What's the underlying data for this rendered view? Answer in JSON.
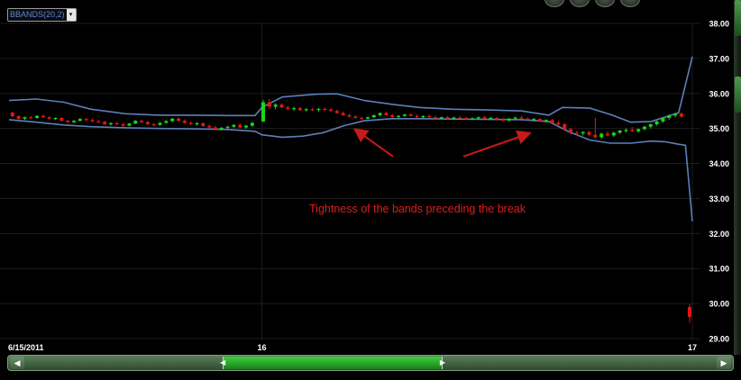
{
  "indicator": {
    "label": "BBANDS(20,2)",
    "arrow": "▾"
  },
  "annotation": {
    "text": "Tightness of the bands preceding the break",
    "color": "#e01c1c"
  },
  "scrollbar": {
    "left_arrow": "◀",
    "right_arrow": "▶",
    "grip_left": "◀",
    "grip_right": "▶"
  },
  "colors": {
    "background": "#000000",
    "grid": "#1d1d1d",
    "band": "#5c80b8",
    "up_candle": "#18d818",
    "down_candle": "#e01818",
    "axis_text": "#ffffff",
    "annotation_arrow": "#c81a1a"
  },
  "chart_data": {
    "type": "candlestick",
    "title": "",
    "xlabel": "",
    "ylabel": "",
    "ylim": [
      29.0,
      38.0
    ],
    "y_ticks": [
      "38.00",
      "37.00",
      "36.00",
      "35.00",
      "34.00",
      "33.00",
      "32.00",
      "31.00",
      "30.00",
      "29.00"
    ],
    "x_tick_labels": [
      {
        "label": "6/15/2011",
        "t": 0
      },
      {
        "label": "16",
        "t": 0.37
      },
      {
        "label": "17",
        "t": 1.0
      }
    ],
    "grid": true,
    "bands": {
      "name": "BBANDS(20,2)",
      "upper": [
        [
          0.0,
          35.8
        ],
        [
          0.04,
          35.84
        ],
        [
          0.08,
          35.75
        ],
        [
          0.12,
          35.55
        ],
        [
          0.17,
          35.42
        ],
        [
          0.22,
          35.38
        ],
        [
          0.27,
          35.38
        ],
        [
          0.32,
          35.37
        ],
        [
          0.36,
          35.37
        ],
        [
          0.37,
          35.6
        ],
        [
          0.4,
          35.9
        ],
        [
          0.45,
          35.98
        ],
        [
          0.48,
          35.99
        ],
        [
          0.52,
          35.8
        ],
        [
          0.56,
          35.69
        ],
        [
          0.6,
          35.6
        ],
        [
          0.65,
          35.55
        ],
        [
          0.7,
          35.53
        ],
        [
          0.75,
          35.5
        ],
        [
          0.79,
          35.38
        ],
        [
          0.81,
          35.6
        ],
        [
          0.85,
          35.58
        ],
        [
          0.88,
          35.4
        ],
        [
          0.91,
          35.18
        ],
        [
          0.94,
          35.2
        ],
        [
          0.98,
          35.45
        ],
        [
          1.0,
          37.05
        ]
      ],
      "middle": [
        [
          0.0,
          35.4
        ],
        [
          0.05,
          35.32
        ],
        [
          0.1,
          35.2
        ],
        [
          0.15,
          35.14
        ],
        [
          0.2,
          35.1
        ],
        [
          0.25,
          35.08
        ],
        [
          0.3,
          35.06
        ],
        [
          0.34,
          35.05
        ],
        [
          0.37,
          35.15
        ],
        [
          0.4,
          35.4
        ],
        [
          0.45,
          35.5
        ],
        [
          0.5,
          35.46
        ],
        [
          0.55,
          35.4
        ],
        [
          0.6,
          35.37
        ],
        [
          0.65,
          35.34
        ],
        [
          0.7,
          35.32
        ],
        [
          0.75,
          35.3
        ],
        [
          0.79,
          35.25
        ],
        [
          0.82,
          35.05
        ],
        [
          0.86,
          34.88
        ],
        [
          0.9,
          34.9
        ],
        [
          0.94,
          34.95
        ],
        [
          0.98,
          35.1
        ],
        [
          1.0,
          35.1
        ]
      ],
      "lower": [
        [
          0.0,
          35.25
        ],
        [
          0.04,
          35.18
        ],
        [
          0.08,
          35.1
        ],
        [
          0.12,
          35.05
        ],
        [
          0.17,
          35.02
        ],
        [
          0.22,
          35.0
        ],
        [
          0.27,
          34.99
        ],
        [
          0.32,
          34.97
        ],
        [
          0.36,
          34.92
        ],
        [
          0.37,
          34.82
        ],
        [
          0.4,
          34.75
        ],
        [
          0.43,
          34.78
        ],
        [
          0.46,
          34.88
        ],
        [
          0.49,
          35.08
        ],
        [
          0.52,
          35.22
        ],
        [
          0.56,
          35.28
        ],
        [
          0.6,
          35.28
        ],
        [
          0.65,
          35.27
        ],
        [
          0.7,
          35.26
        ],
        [
          0.75,
          35.25
        ],
        [
          0.79,
          35.2
        ],
        [
          0.82,
          34.9
        ],
        [
          0.85,
          34.67
        ],
        [
          0.88,
          34.58
        ],
        [
          0.91,
          34.58
        ],
        [
          0.94,
          34.64
        ],
        [
          0.96,
          34.62
        ],
        [
          0.98,
          34.55
        ],
        [
          0.99,
          34.52
        ],
        [
          1.0,
          32.35
        ]
      ]
    },
    "candles": [
      [
        0.005,
        35.45,
        35.48,
        35.32,
        35.35
      ],
      [
        0.014,
        35.35,
        35.38,
        35.25,
        35.28
      ],
      [
        0.023,
        35.28,
        35.34,
        35.24,
        35.32
      ],
      [
        0.032,
        35.32,
        35.36,
        35.28,
        35.3
      ],
      [
        0.041,
        35.3,
        35.38,
        35.28,
        35.36
      ],
      [
        0.05,
        35.36,
        35.4,
        35.3,
        35.32
      ],
      [
        0.059,
        35.32,
        35.35,
        35.25,
        35.28
      ],
      [
        0.068,
        35.28,
        35.32,
        35.24,
        35.3
      ],
      [
        0.077,
        35.3,
        35.32,
        35.2,
        35.22
      ],
      [
        0.086,
        35.22,
        35.25,
        35.16,
        35.18
      ],
      [
        0.095,
        35.18,
        35.24,
        35.15,
        35.22
      ],
      [
        0.104,
        35.22,
        35.3,
        35.2,
        35.27
      ],
      [
        0.113,
        35.27,
        35.3,
        35.2,
        35.24
      ],
      [
        0.122,
        35.24,
        35.28,
        35.18,
        35.2
      ],
      [
        0.131,
        35.2,
        35.25,
        35.16,
        35.19
      ],
      [
        0.14,
        35.19,
        35.22,
        35.1,
        35.12
      ],
      [
        0.149,
        35.12,
        35.18,
        35.08,
        35.15
      ],
      [
        0.158,
        35.15,
        35.2,
        35.1,
        35.12
      ],
      [
        0.167,
        35.12,
        35.16,
        35.04,
        35.08
      ],
      [
        0.176,
        35.08,
        35.16,
        35.06,
        35.14
      ],
      [
        0.185,
        35.14,
        35.24,
        35.12,
        35.22
      ],
      [
        0.194,
        35.22,
        35.26,
        35.16,
        35.18
      ],
      [
        0.203,
        35.18,
        35.22,
        35.1,
        35.12
      ],
      [
        0.212,
        35.12,
        35.16,
        35.06,
        35.1
      ],
      [
        0.221,
        35.1,
        35.18,
        35.08,
        35.16
      ],
      [
        0.23,
        35.16,
        35.24,
        35.14,
        35.21
      ],
      [
        0.239,
        35.21,
        35.3,
        35.18,
        35.28
      ],
      [
        0.248,
        35.28,
        35.32,
        35.2,
        35.22
      ],
      [
        0.257,
        35.22,
        35.26,
        35.14,
        35.16
      ],
      [
        0.266,
        35.16,
        35.2,
        35.1,
        35.13
      ],
      [
        0.275,
        35.13,
        35.18,
        35.08,
        35.15
      ],
      [
        0.284,
        35.15,
        35.18,
        35.05,
        35.07
      ],
      [
        0.293,
        35.07,
        35.12,
        35.0,
        35.03
      ],
      [
        0.302,
        35.03,
        35.08,
        34.95,
        34.98
      ],
      [
        0.311,
        34.98,
        35.04,
        34.94,
        35.02
      ],
      [
        0.32,
        35.02,
        35.08,
        34.98,
        35.05
      ],
      [
        0.329,
        35.05,
        35.12,
        35.02,
        35.1
      ],
      [
        0.338,
        35.1,
        35.15,
        35.0,
        35.03
      ],
      [
        0.347,
        35.03,
        35.1,
        34.99,
        35.08
      ],
      [
        0.356,
        35.08,
        35.18,
        35.05,
        35.16
      ],
      [
        0.372,
        35.2,
        35.82,
        35.18,
        35.75
      ],
      [
        0.381,
        35.75,
        35.85,
        35.55,
        35.62
      ],
      [
        0.39,
        35.62,
        35.72,
        35.55,
        35.68
      ],
      [
        0.399,
        35.68,
        35.72,
        35.58,
        35.6
      ],
      [
        0.408,
        35.6,
        35.65,
        35.52,
        35.56
      ],
      [
        0.417,
        35.56,
        35.62,
        35.5,
        35.58
      ],
      [
        0.426,
        35.58,
        35.62,
        35.5,
        35.52
      ],
      [
        0.435,
        35.52,
        35.58,
        35.48,
        35.55
      ],
      [
        0.444,
        35.55,
        35.58,
        35.5,
        35.53
      ],
      [
        0.453,
        35.53,
        35.58,
        35.48,
        35.56
      ],
      [
        0.462,
        35.56,
        35.6,
        35.5,
        35.54
      ],
      [
        0.471,
        35.54,
        35.58,
        35.48,
        35.5
      ],
      [
        0.48,
        35.5,
        35.54,
        35.42,
        35.44
      ],
      [
        0.489,
        35.44,
        35.48,
        35.36,
        35.38
      ],
      [
        0.498,
        35.38,
        35.42,
        35.32,
        35.34
      ],
      [
        0.507,
        35.34,
        35.38,
        35.28,
        35.3
      ],
      [
        0.516,
        35.3,
        35.34,
        35.24,
        35.28
      ],
      [
        0.525,
        35.28,
        35.34,
        35.26,
        35.32
      ],
      [
        0.534,
        35.32,
        35.4,
        35.3,
        35.38
      ],
      [
        0.543,
        35.38,
        35.46,
        35.34,
        35.44
      ],
      [
        0.552,
        35.44,
        35.48,
        35.36,
        35.38
      ],
      [
        0.561,
        35.38,
        35.42,
        35.3,
        35.33
      ],
      [
        0.57,
        35.33,
        35.38,
        35.28,
        35.36
      ],
      [
        0.579,
        35.36,
        35.42,
        35.33,
        35.4
      ],
      [
        0.588,
        35.4,
        35.44,
        35.34,
        35.36
      ],
      [
        0.597,
        35.36,
        35.4,
        35.3,
        35.33
      ],
      [
        0.606,
        35.33,
        35.38,
        35.28,
        35.35
      ],
      [
        0.615,
        35.35,
        35.4,
        35.3,
        35.32
      ],
      [
        0.624,
        35.32,
        35.36,
        35.26,
        35.29
      ],
      [
        0.633,
        35.29,
        35.34,
        35.26,
        35.32
      ],
      [
        0.642,
        35.32,
        35.36,
        35.26,
        35.28
      ],
      [
        0.651,
        35.28,
        35.34,
        35.24,
        35.31
      ],
      [
        0.66,
        35.31,
        35.36,
        35.28,
        35.3
      ],
      [
        0.669,
        35.3,
        35.34,
        35.24,
        35.27
      ],
      [
        0.678,
        35.27,
        35.32,
        35.24,
        35.29
      ],
      [
        0.687,
        35.29,
        35.34,
        35.26,
        35.32
      ],
      [
        0.696,
        35.32,
        35.36,
        35.26,
        35.28
      ],
      [
        0.705,
        35.28,
        35.33,
        35.24,
        35.3
      ],
      [
        0.714,
        35.3,
        35.34,
        35.24,
        35.26
      ],
      [
        0.723,
        35.26,
        35.3,
        35.2,
        35.23
      ],
      [
        0.732,
        35.23,
        35.3,
        35.2,
        35.28
      ],
      [
        0.741,
        35.28,
        35.34,
        35.24,
        35.31
      ],
      [
        0.75,
        35.31,
        35.36,
        35.26,
        35.28
      ],
      [
        0.759,
        35.28,
        35.32,
        35.22,
        35.25
      ],
      [
        0.768,
        35.25,
        35.3,
        35.2,
        35.27
      ],
      [
        0.777,
        35.27,
        35.3,
        35.18,
        35.2
      ],
      [
        0.786,
        35.2,
        35.26,
        35.16,
        35.24
      ],
      [
        0.795,
        35.24,
        35.28,
        35.14,
        35.16
      ],
      [
        0.804,
        35.16,
        35.22,
        35.08,
        35.12
      ],
      [
        0.813,
        35.12,
        35.16,
        34.95,
        34.98
      ],
      [
        0.822,
        34.98,
        35.02,
        34.84,
        34.88
      ],
      [
        0.831,
        34.88,
        34.94,
        34.8,
        34.86
      ],
      [
        0.84,
        34.86,
        34.92,
        34.8,
        34.9
      ],
      [
        0.849,
        34.9,
        34.94,
        34.78,
        34.82
      ],
      [
        0.858,
        34.82,
        35.3,
        34.7,
        34.75
      ],
      [
        0.867,
        34.75,
        34.88,
        34.7,
        34.85
      ],
      [
        0.876,
        34.85,
        34.92,
        34.78,
        34.8
      ],
      [
        0.885,
        34.8,
        34.9,
        34.76,
        34.88
      ],
      [
        0.894,
        34.88,
        34.96,
        34.84,
        34.94
      ],
      [
        0.903,
        34.94,
        35.0,
        34.88,
        34.96
      ],
      [
        0.912,
        34.96,
        35.04,
        34.9,
        34.92
      ],
      [
        0.921,
        34.92,
        35.0,
        34.88,
        34.98
      ],
      [
        0.93,
        34.98,
        35.08,
        34.95,
        35.05
      ],
      [
        0.939,
        35.05,
        35.14,
        35.0,
        35.12
      ],
      [
        0.948,
        35.12,
        35.22,
        35.08,
        35.2
      ],
      [
        0.957,
        35.2,
        35.32,
        35.16,
        35.3
      ],
      [
        0.966,
        35.3,
        35.4,
        35.25,
        35.37
      ],
      [
        0.975,
        35.37,
        35.45,
        35.32,
        35.42
      ],
      [
        0.984,
        35.42,
        35.46,
        35.3,
        35.34
      ],
      [
        0.996,
        29.9,
        29.98,
        29.45,
        29.62
      ]
    ],
    "annotation_arrows": [
      {
        "from": [
          0.562,
          34.2
        ],
        "to": [
          0.508,
          34.95
        ]
      },
      {
        "from": [
          0.665,
          34.2
        ],
        "to": [
          0.76,
          34.85
        ]
      }
    ]
  }
}
